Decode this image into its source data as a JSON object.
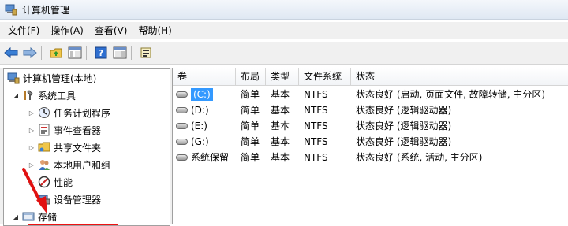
{
  "window": {
    "title": "计算机管理"
  },
  "menu": [
    "文件(F)",
    "操作(A)",
    "查看(V)",
    "帮助(H)"
  ],
  "toolbar": {
    "buttons": [
      "back-icon",
      "forward-icon",
      "up-folder-icon",
      "show-hide-tree-icon",
      "help-icon",
      "properties-icon",
      "export-icon"
    ]
  },
  "tree": {
    "root": "计算机管理(本地)",
    "system_tools": "系统工具",
    "items": [
      "任务计划程序",
      "事件查看器",
      "共享文件夹",
      "本地用户和组",
      "性能",
      "设备管理器"
    ],
    "storage": "存储"
  },
  "list": {
    "columns": [
      "卷",
      "布局",
      "类型",
      "文件系统",
      "状态"
    ],
    "rows": [
      {
        "vol": "(C:)",
        "layout": "简单",
        "type": "基本",
        "fs": "NTFS",
        "status": "状态良好 (启动, 页面文件, 故障转储, 主分区)",
        "selected": true
      },
      {
        "vol": "(D:)",
        "layout": "简单",
        "type": "基本",
        "fs": "NTFS",
        "status": "状态良好 (逻辑驱动器)"
      },
      {
        "vol": "(E:)",
        "layout": "简单",
        "type": "基本",
        "fs": "NTFS",
        "status": "状态良好 (逻辑驱动器)"
      },
      {
        "vol": "(G:)",
        "layout": "简单",
        "type": "基本",
        "fs": "NTFS",
        "status": "状态良好 (逻辑驱动器)"
      },
      {
        "vol": "系统保留",
        "layout": "简单",
        "type": "基本",
        "fs": "NTFS",
        "status": "状态良好 (系统, 活动, 主分区)"
      }
    ]
  },
  "colors": {
    "selection": "#3399ff",
    "annotation": "#e11111"
  }
}
